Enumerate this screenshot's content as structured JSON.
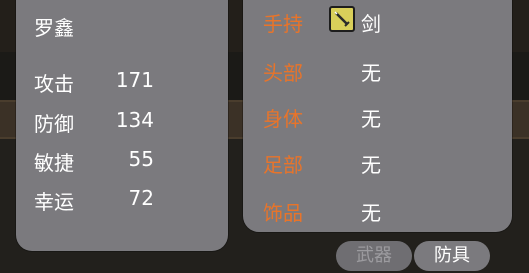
{
  "character": {
    "name": "罗鑫"
  },
  "stats": [
    {
      "label": "攻击",
      "value": "171"
    },
    {
      "label": "防御",
      "value": "134"
    },
    {
      "label": "敏捷",
      "value": "55"
    },
    {
      "label": "幸运",
      "value": "72"
    }
  ],
  "equipment": [
    {
      "slot": "手持",
      "item": "剑",
      "icon": "sword-icon"
    },
    {
      "slot": "头部",
      "item": "无"
    },
    {
      "slot": "身体",
      "item": "无"
    },
    {
      "slot": "足部",
      "item": "无"
    },
    {
      "slot": "饰品",
      "item": "无"
    }
  ],
  "tabs": {
    "weapon": "武器",
    "armor": "防具"
  },
  "colors": {
    "panel": "#7b7a7e",
    "slot_label": "#e8742a",
    "text": "#ffffff",
    "tab_disabled_text": "#9c9b9f"
  }
}
